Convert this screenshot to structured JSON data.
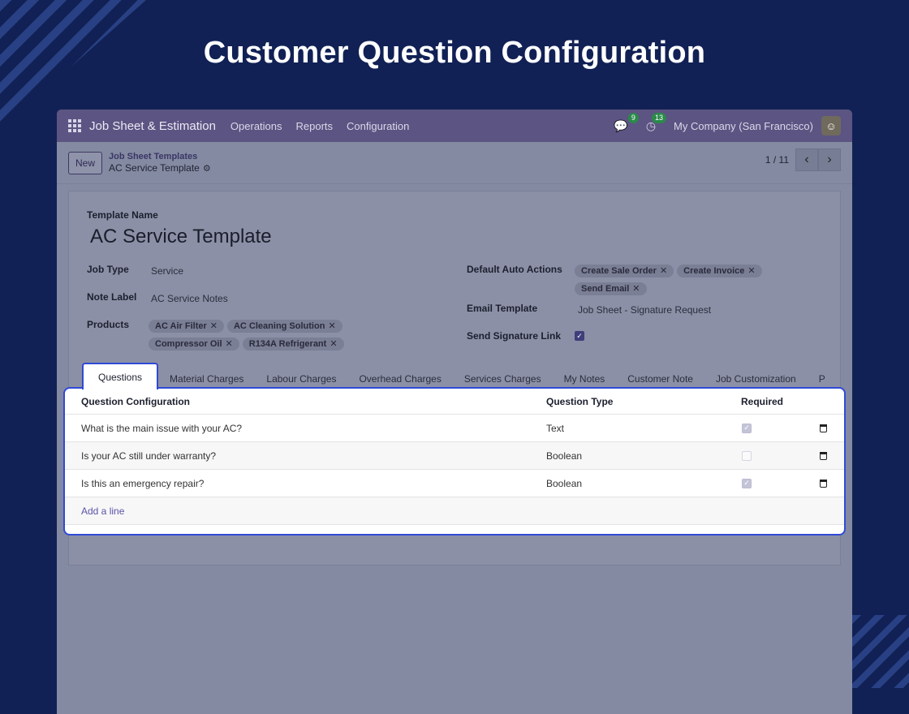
{
  "hero": {
    "title": "Customer Question Configuration"
  },
  "navbar": {
    "brand": "Job Sheet & Estimation",
    "menu": [
      "Operations",
      "Reports",
      "Configuration"
    ],
    "messages_badge": "9",
    "activities_badge": "13",
    "company": "My Company (San Francisco)"
  },
  "control_panel": {
    "new_label": "New",
    "breadcrumb_parent": "Job Sheet Templates",
    "breadcrumb_current": "AC Service Template",
    "pager": "1 / 11"
  },
  "form": {
    "template_name_label": "Template Name",
    "template_name": "AC Service Template",
    "job_type_label": "Job Type",
    "job_type": "Service",
    "note_label_label": "Note Label",
    "note_label": "AC Service Notes",
    "products_label": "Products",
    "products": [
      "AC Air Filter",
      "AC Cleaning Solution",
      "Compressor Oil",
      "R134A Refrigerant"
    ],
    "auto_actions_label": "Default Auto Actions",
    "auto_actions": [
      "Create Sale Order",
      "Create Invoice",
      "Send Email"
    ],
    "email_template_label": "Email Template",
    "email_template": "Job Sheet - Signature Request",
    "send_signature_label": "Send Signature Link",
    "send_signature": true
  },
  "tabs": [
    "Questions",
    "Material Charges",
    "Labour Charges",
    "Overhead Charges",
    "Services Charges",
    "My Notes",
    "Customer Note",
    "Job Customization",
    "P"
  ],
  "questions": {
    "headers": {
      "question": "Question Configuration",
      "type": "Question Type",
      "required": "Required"
    },
    "rows": [
      {
        "question": "What is the main issue with your AC?",
        "type": "Text",
        "required": true
      },
      {
        "question": "Is your AC still under warranty?",
        "type": "Boolean",
        "required": false
      },
      {
        "question": "Is this an emergency repair?",
        "type": "Boolean",
        "required": true
      }
    ],
    "add_line": "Add a line"
  }
}
